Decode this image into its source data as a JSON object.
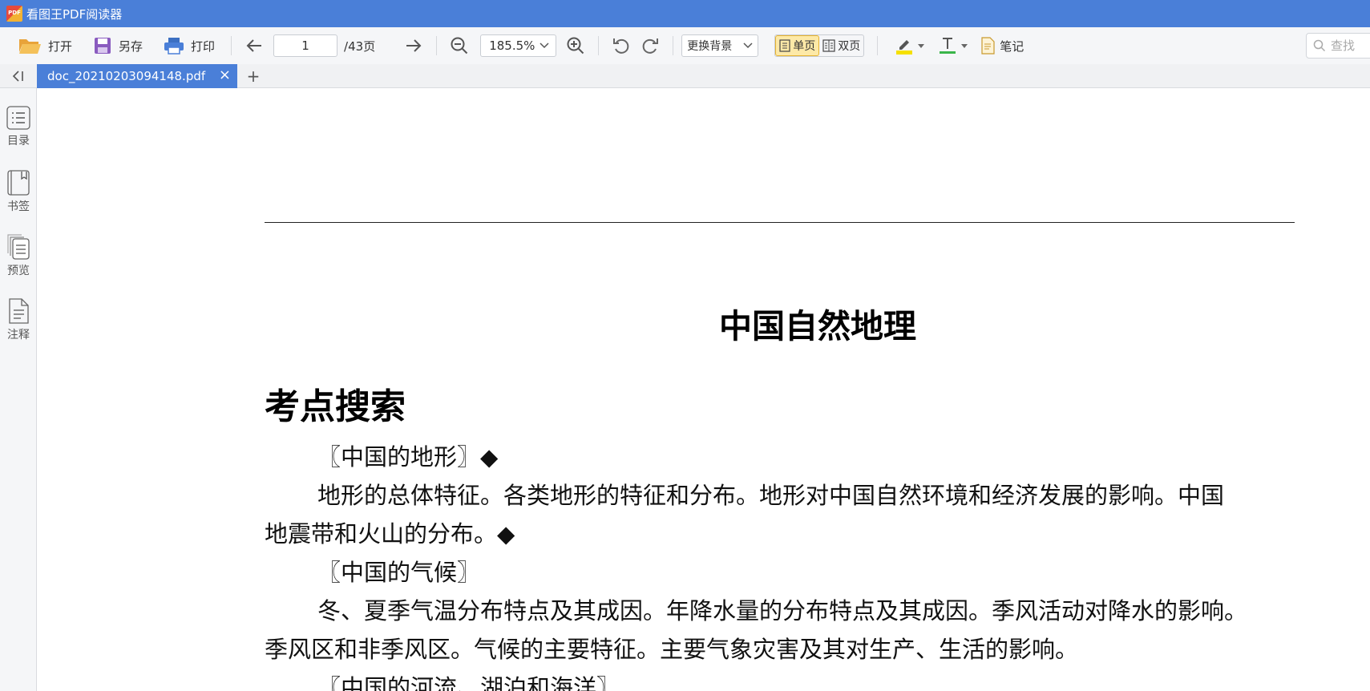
{
  "app": {
    "title": "看图王PDF阅读器"
  },
  "toolbar": {
    "open_label": "打开",
    "save_as_label": "另存",
    "print_label": "打印",
    "page_current": "1",
    "page_total": "/43页",
    "zoom_value": "185.5%",
    "background_label": "更换背景",
    "single_page_label": "单页",
    "double_page_label": "双页",
    "notes_label": "笔记",
    "search_placeholder": "查找",
    "highlight_color": "#f5e000",
    "text_color": "#3ab54a"
  },
  "tabs": [
    {
      "label": "doc_20210203094148.pdf",
      "close": "×"
    }
  ],
  "add_tab": "+",
  "sidebar": {
    "items": [
      {
        "label": "目录",
        "icon": "list-icon"
      },
      {
        "label": "书签",
        "icon": "bookmark-icon"
      },
      {
        "label": "预览",
        "icon": "pages-icon"
      },
      {
        "label": "注释",
        "icon": "note-icon"
      }
    ]
  },
  "document": {
    "title": "中国自然地理",
    "heading": "考点搜索",
    "lines": [
      "〖中国的地形〗◆",
      "地形的总体特征。各类地形的特征和分布。地形对中国自然环境和经济发展的影响。中国",
      "地震带和火山的分布。◆",
      "〖中国的气候〗",
      "冬、夏季气温分布特点及其成因。年降水量的分布特点及其成因。季风活动对降水的影响。",
      "季风区和非季风区。气候的主要特征。主要气象灾害及其对生产、生活的影响。",
      "〖中国的河流、湖泊和海洋〗"
    ]
  }
}
